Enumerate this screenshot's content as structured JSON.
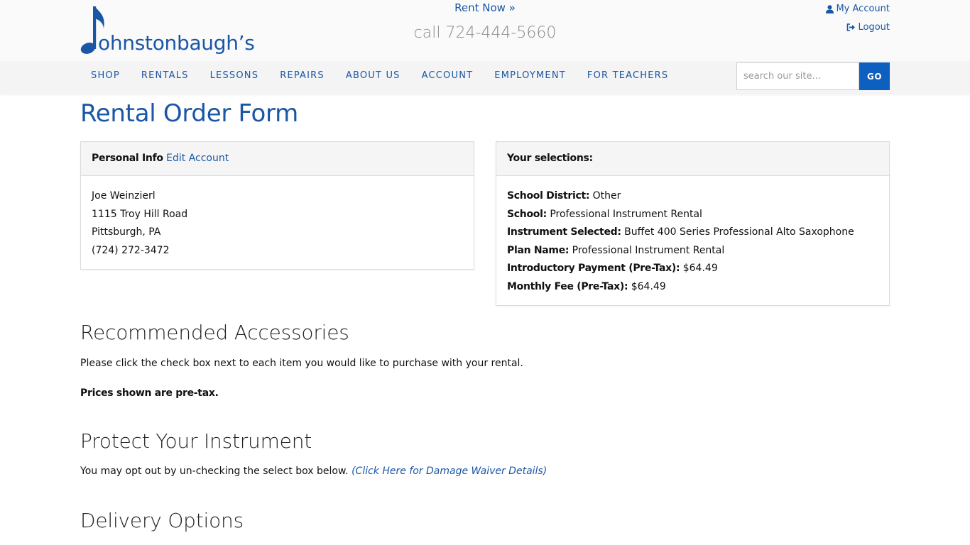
{
  "header": {
    "logo_text": "ohnstonbaugh’s",
    "rent_now": "Rent Now »",
    "phone": "call 724-444-5660",
    "my_account": "My Account",
    "logout": "Logout",
    "brand_color": "#1a56a6"
  },
  "nav": {
    "items": [
      "SHOP",
      "RENTALS",
      "LESSONS",
      "REPAIRS",
      "ABOUT US",
      "ACCOUNT",
      "EMPLOYMENT",
      "FOR TEACHERS"
    ],
    "search_placeholder": "search our site...",
    "search_button": "GO"
  },
  "main": {
    "title": "Rental Order Form",
    "personal_info": {
      "heading": "Personal Info",
      "edit_link": "Edit Account",
      "name": "Joe Weinzierl",
      "address": "1115 Troy Hill Road",
      "city": "Pittsburgh, PA",
      "phone": "(724) 272-3472"
    },
    "selections": {
      "heading": "Your selections:",
      "rows": [
        {
          "label": "School District:",
          "value": "Other"
        },
        {
          "label": "School:",
          "value": "Professional Instrument Rental"
        },
        {
          "label": "Instrument Selected:",
          "value": "Buffet 400 Series Professional Alto Saxophone"
        },
        {
          "label": "Plan Name:",
          "value": "Professional Instrument Rental"
        },
        {
          "label": "Introductory Payment (Pre-Tax):",
          "value": "$64.49"
        },
        {
          "label": "Monthly Fee (Pre-Tax):",
          "value": "$64.49"
        }
      ]
    },
    "accessories": {
      "heading": "Recommended Accessories",
      "instruction": "Please click the check box next to each item you would like to purchase with your rental.",
      "note": "Prices shown are pre-tax."
    },
    "protect": {
      "heading": "Protect Your Instrument",
      "text": "You may opt out by un-checking the select box below.",
      "link": "(Click Here for Damage Waiver Details)"
    },
    "delivery": {
      "heading": "Delivery Options"
    }
  }
}
